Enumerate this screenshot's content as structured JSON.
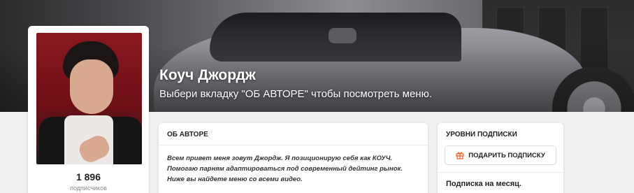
{
  "header": {
    "title": "Коуч Джордж",
    "subtitle": "Выбери вкладку \"ОБ АВТОРЕ\" чтобы посмотреть меню."
  },
  "profile": {
    "subscribers_count": "1 896",
    "subscribers_label": "подписчиков"
  },
  "about": {
    "heading": "ОБ АВТОРЕ",
    "text": "Всем привет меня зовут Джордж. Я позиционирую себя как КОУЧ. Помогаю парням адаптироваться под современный дейтинг рынок. Ниже вы найдете меню со всеми видео."
  },
  "levels": {
    "heading": "УРОВНИ ПОДПИСКИ",
    "gift_button": "ПОДАРИТЬ ПОДПИСКУ",
    "gift_icon": "gift-icon",
    "first_level": "Подписка на месяц."
  },
  "colors": {
    "accent_gift": "#e8622c",
    "background": "#f0f0f0"
  }
}
